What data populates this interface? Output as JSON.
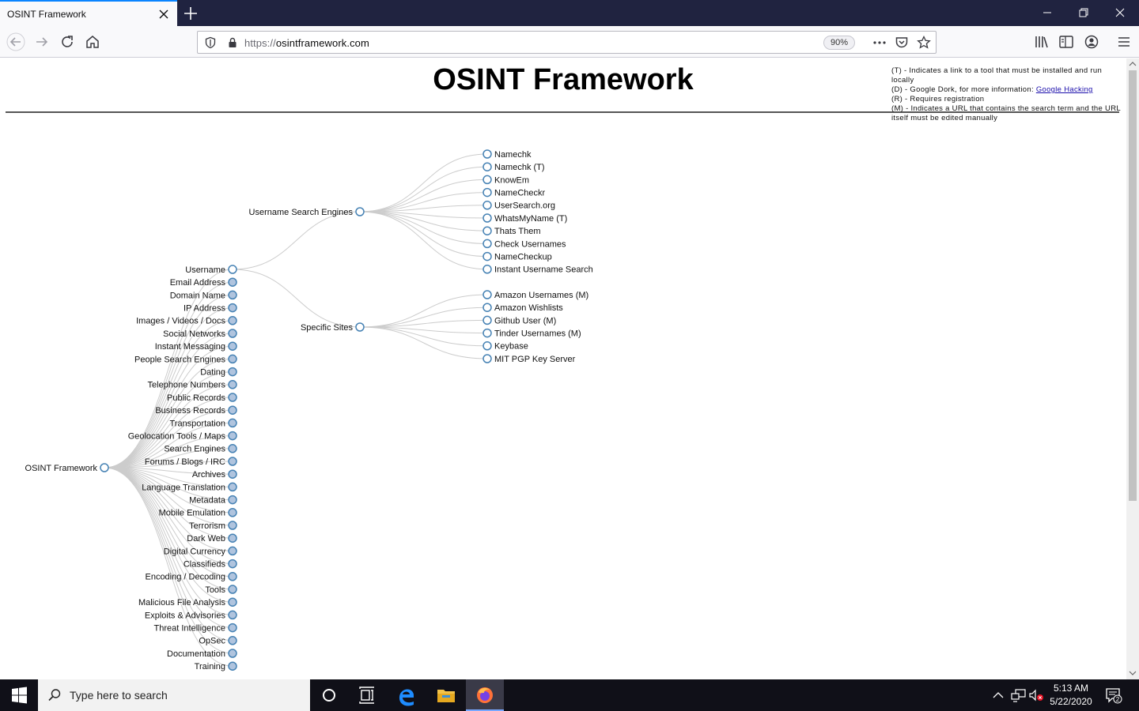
{
  "browser": {
    "tab_title": "OSINT Framework",
    "url_scheme": "https://",
    "url_host": "osintframework.com",
    "zoom": "90%"
  },
  "page": {
    "title": "OSINT Framework",
    "legend": {
      "t": "(T) - Indicates a link to a tool that must be installed and run locally",
      "d_prefix": "(D) - Google Dork, for more information: ",
      "d_link": "Google Hacking",
      "r": "(R) - Requires registration",
      "m": "(M) - Indicates a URL that contains the search term and the URL itself must be edited manually"
    }
  },
  "tree": {
    "root": "OSINT Framework",
    "categories": [
      "Username",
      "Email Address",
      "Domain Name",
      "IP Address",
      "Images / Videos / Docs",
      "Social Networks",
      "Instant Messaging",
      "People Search Engines",
      "Dating",
      "Telephone Numbers",
      "Public Records",
      "Business Records",
      "Transportation",
      "Geolocation Tools / Maps",
      "Search Engines",
      "Forums / Blogs / IRC",
      "Archives",
      "Language Translation",
      "Metadata",
      "Mobile Emulation",
      "Terrorism",
      "Dark Web",
      "Digital Currency",
      "Classifieds",
      "Encoding / Decoding",
      "Tools",
      "Malicious File Analysis",
      "Exploits & Advisories",
      "Threat Intelligence",
      "OpSec",
      "Documentation",
      "Training"
    ],
    "username_children": [
      "Username Search Engines",
      "Specific Sites"
    ],
    "username_search_engines": [
      "Namechk",
      "Namechk (T)",
      "KnowEm",
      "NameCheckr",
      "UserSearch.org",
      "WhatsMyName (T)",
      "Thats Them",
      "Check Usernames",
      "NameCheckup",
      "Instant Username Search"
    ],
    "specific_sites": [
      "Amazon Usernames (M)",
      "Amazon Wishlists",
      "Github User (M)",
      "Tinder Usernames (M)",
      "Keybase",
      "MIT PGP Key Server"
    ]
  },
  "taskbar": {
    "search_placeholder": "Type here to search",
    "time": "5:13 AM",
    "date": "5/22/2020",
    "notification_count": "2"
  },
  "colors": {
    "titlebar": "#202340",
    "node_fill_collapsed": "#b0c4de",
    "node_stroke": "#4682b4",
    "link": "#cccccc",
    "firefox_accent": "#0a84ff"
  }
}
